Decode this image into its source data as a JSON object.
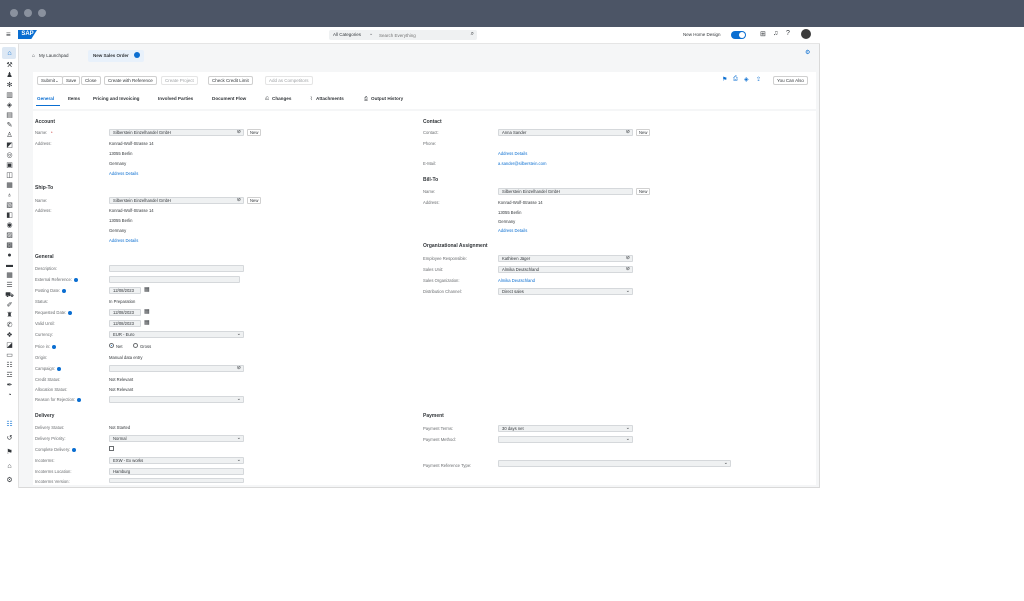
{
  "shell": {
    "logo": "SAP",
    "search_category": "All Categories",
    "search_placeholder": "Search Everything",
    "new_design_label": "New Home Design",
    "new_design_on": true
  },
  "tabs": {
    "launchpad": "My Launchpad",
    "current": "New Sales Order"
  },
  "actions": {
    "submit": "Submit",
    "save": "Save",
    "close": "Close",
    "create_ref": "Create with Reference",
    "create_project": "Create Project",
    "check_credit": "Check Credit Limit",
    "add_competitors": "Add as Competitors",
    "you_can_also": "You Can Also"
  },
  "nav_tabs": [
    "General",
    "Items",
    "Pricing and Invoicing",
    "Involved Parties",
    "Document Flow",
    "Changes",
    "Attachments",
    "Output History"
  ],
  "account": {
    "title": "Account",
    "name_label": "Name:",
    "name_value": "Silberstein Einzelhandel GmbH",
    "new_button": "New",
    "address_label": "Address:",
    "address_lines": [
      "Konrad-Wolf-Strasse 14",
      "13055 Berlin",
      "Germany"
    ],
    "address_link": "Address Details"
  },
  "ship_to": {
    "title": "Ship-To",
    "name_label": "Name:",
    "name_value": "Silberstein Einzelhandel GmbH",
    "new_button": "New",
    "address_label": "Address:",
    "address_lines": [
      "Konrad-Wolf-Strasse 14",
      "13055 Berlin",
      "Germany"
    ],
    "address_link": "Address Details"
  },
  "general": {
    "title": "General",
    "description_label": "Description:",
    "ext_ref_label": "External Reference:",
    "posting_date_label": "Posting Date:",
    "posting_date": "12/08/2023",
    "status_label": "Status:",
    "status_value": "In Preparation",
    "req_date_label": "Requested Date:",
    "req_date": "12/08/2023",
    "valid_to_label": "Valid Until:",
    "valid_to": "12/08/2023",
    "currency_label": "Currency:",
    "currency_value": "EUR - Euro",
    "price_label": "Price in:",
    "price_net": "Net",
    "price_gross": "Gross",
    "origin_label": "Origin:",
    "origin_value": "Manual data entry",
    "campaign_label": "Campaign:",
    "credit_status_label": "Credit Status:",
    "credit_status": "Not Relevant",
    "allocation_label": "Allocation Status:",
    "allocation_value": "Not Relevant",
    "reason_label": "Reason for Rejection:"
  },
  "delivery": {
    "title": "Delivery",
    "status_label": "Delivery Status:",
    "status_value": "Not Started",
    "priority_label": "Delivery Priority:",
    "priority_value": "Normal",
    "complete_label": "Complete Delivery:",
    "incoterms_label": "Incoterms:",
    "incoterms_value": "EXW - Ex works",
    "incoterms_loc_label": "Incoterms Location:",
    "incoterms_loc_value": "Hamburg",
    "third_label": "Incoterms Version:"
  },
  "contact": {
    "title": "Contact",
    "contact_label": "Contact:",
    "contact_value": "Anna Sander",
    "new_button": "New",
    "phone_label": "Phone:",
    "address_link": "Address Details",
    "email_label": "E-Mail:",
    "email_value": "a.sander@silberstein.com"
  },
  "bill_to": {
    "title": "Bill-To",
    "name_label": "Name:",
    "name_value": "Silberstein Einzelhandel GmbH",
    "new_button": "New",
    "address_label": "Address:",
    "address_lines": [
      "Konrad-Wolf-Strasse 14",
      "13055 Berlin",
      "Germany"
    ],
    "address_link": "Address Details"
  },
  "org": {
    "title": "Organizational Assignment",
    "employee_label": "Employee Responsible:",
    "employee_value": "Kathleen Jäger",
    "sales_unit_label": "Sales Unit:",
    "sales_unit_value": "Almika Deutschland",
    "sales_org_label": "Sales Organization:",
    "sales_org_value": "Almika Deutschland",
    "dist_label": "Distribution Channel:",
    "dist_value": "Direct sales"
  },
  "payment": {
    "title": "Payment",
    "terms_label": "Payment Terms:",
    "terms_value": "30 days net",
    "method_label": "Payment Method:",
    "ref_type_label": "Payment Reference Type:"
  }
}
